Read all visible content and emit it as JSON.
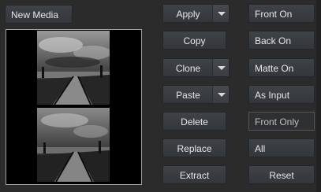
{
  "header": {
    "new_media_label": "New Media"
  },
  "buttons_mid": {
    "apply": "Apply",
    "copy": "Copy",
    "clone": "Clone",
    "paste": "Paste",
    "delete": "Delete",
    "replace": "Replace",
    "extract": "Extract"
  },
  "buttons_right": {
    "front_on": "Front On",
    "back_on": "Back On",
    "matte_on": "Matte On",
    "as_input": "As Input",
    "front_only": "Front Only",
    "all": "All",
    "reset": "Reset"
  },
  "icons": [
    "dropdown-arrow-icon"
  ]
}
